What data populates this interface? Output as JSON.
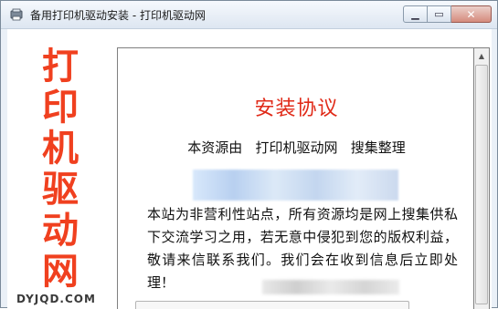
{
  "window": {
    "title": "备用打印机驱动安装 - 打印机驱动网",
    "minimize_icon": "minimize-icon",
    "maximize_icon": "maximize-icon",
    "close_icon": "close-icon",
    "close_glyph": "✕",
    "minimize_glyph": "▁",
    "maximize_glyph": "▭"
  },
  "logo": {
    "chars": [
      "打",
      "印",
      "机",
      "驱",
      "动",
      "网"
    ],
    "brand": "DYJQD.COM",
    "color": "#f0401f"
  },
  "agreement": {
    "title": "安装协议",
    "subtitle": "本资源由   打印机驱动网   搜集整理",
    "body": "本站为非营利性站点，所有资源均是网上搜集供私下交流学习之用，若无意中侵犯到您的版权利益，敬请来信联系我们。我们会在收到信息后立即处理！",
    "title_color": "#e02a18"
  },
  "scrollbar": {
    "up_arrow_glyph": "▲"
  }
}
